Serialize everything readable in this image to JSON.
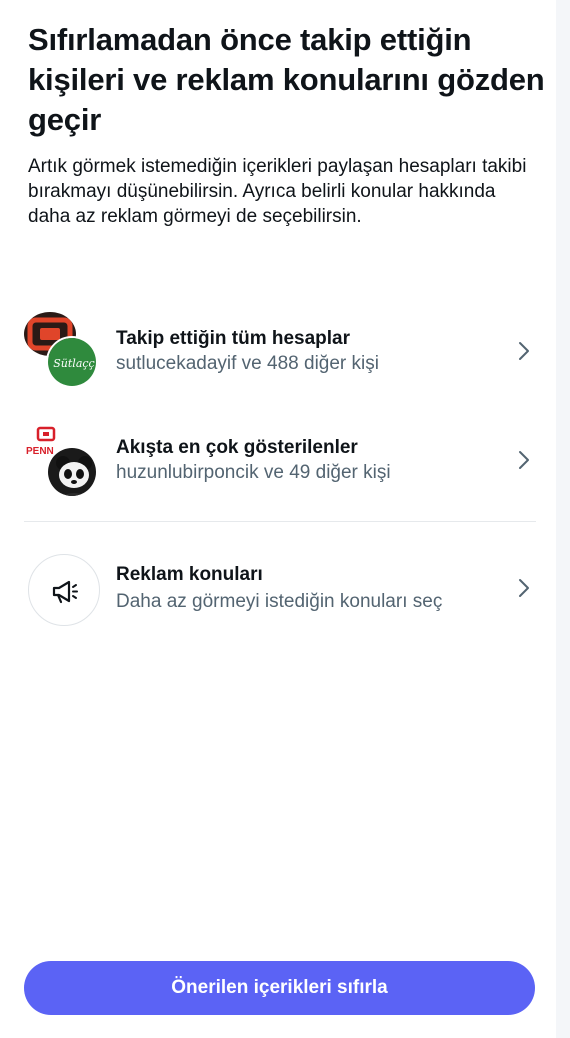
{
  "title": "Sıfırlamadan önce takip ettiğin kişileri ve reklam konularını gözden geçir",
  "description": "Artık görmek istemediğin içerikleri paylaşan hesapları takibi bırakmayı düşünebilirsin. Ayrıca belirli konular hakkında daha az reklam görmeyi de seçebilirsin.",
  "rows": [
    {
      "label": "Takip ettiğin tüm hesaplar",
      "sub": "sutlucekadayif ve 488 diğer kişi",
      "icons": [
        "tv-logo-icon",
        "sutlace-logo-icon"
      ]
    },
    {
      "label": "Akışta en çok gösterilenler",
      "sub": "huzunlubirponcik ve 49 diğer kişi",
      "icons": [
        "penn-logo-icon",
        "panda-avatar-icon"
      ]
    },
    {
      "label": "Reklam konuları",
      "sub": "Daha az görmeyi istediğin konuları seç",
      "icons": [
        "megaphone-icon"
      ]
    }
  ],
  "logos": {
    "sutlace": "Sütlaçç",
    "penn": "PENN"
  },
  "button": {
    "label": "Önerilen içerikleri sıfırla"
  },
  "colors": {
    "accent": "#5b63f5",
    "text": "#0f1419",
    "secondary": "#536471"
  }
}
